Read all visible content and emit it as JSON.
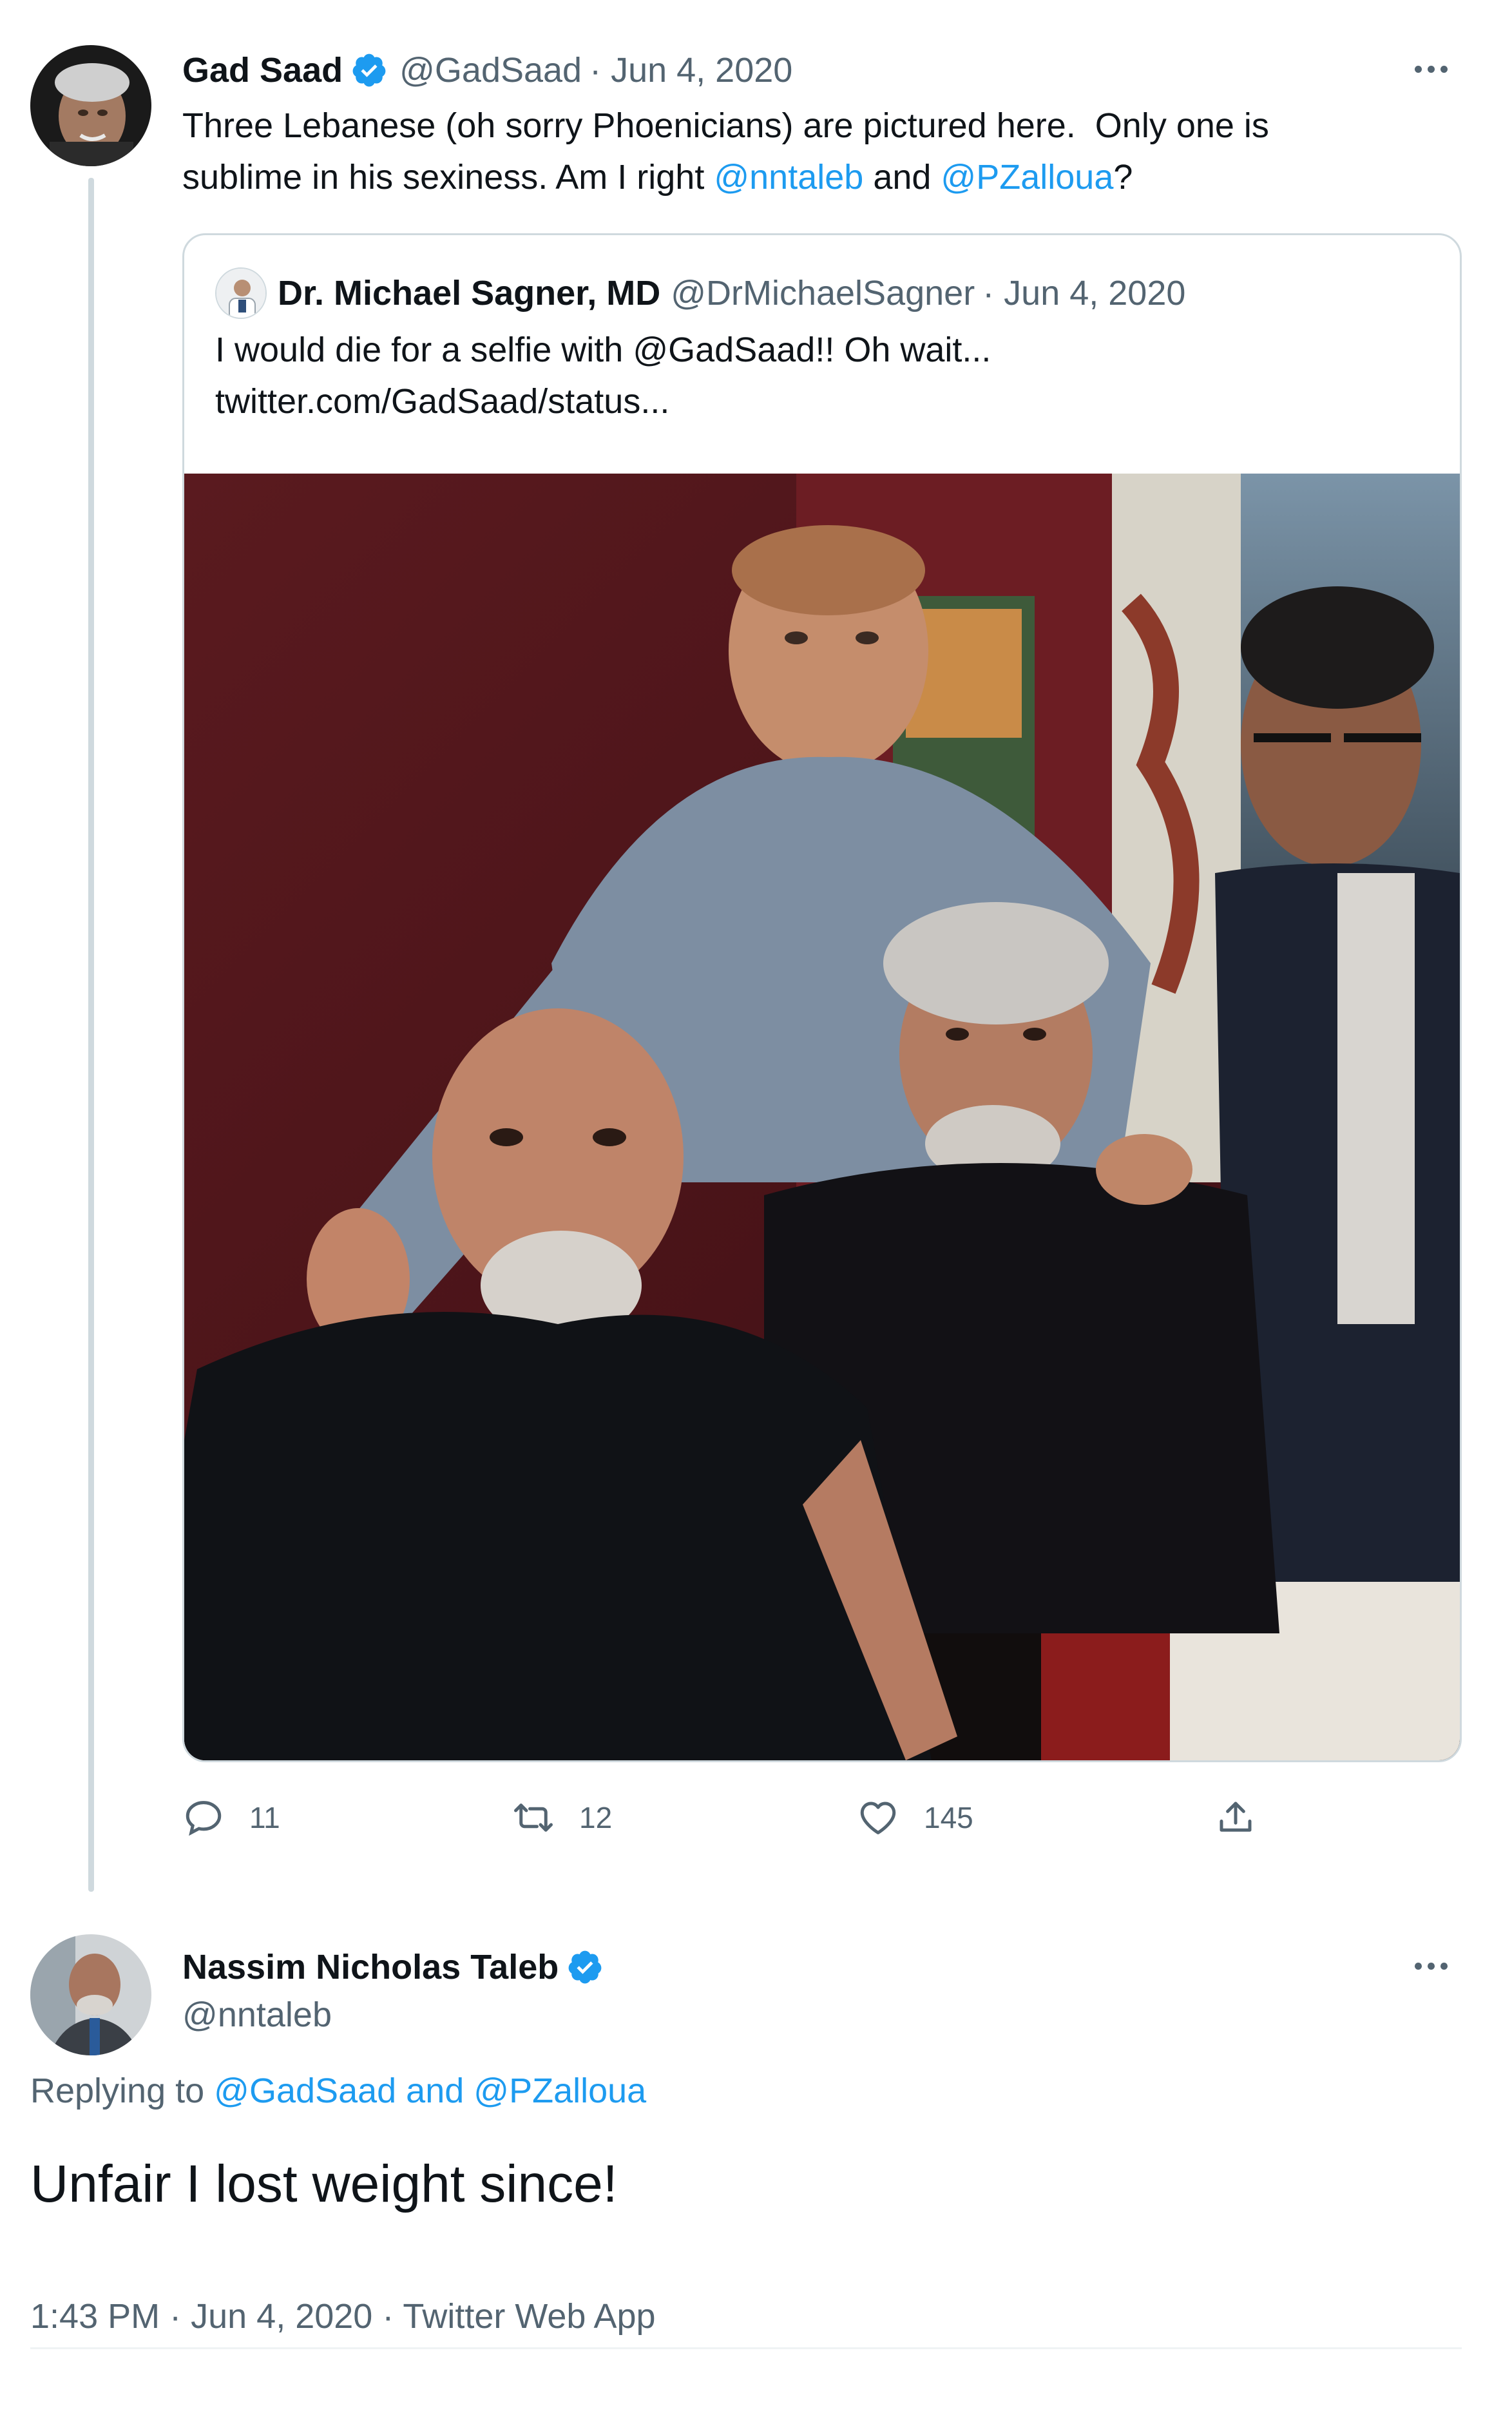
{
  "tweet1": {
    "author_name": "Gad Saad",
    "handle": "@GadSaad",
    "date": "· Jun 4, 2020",
    "text_line1": "Three Lebanese (oh sorry Phoenicians) are pictured here.  Only one is",
    "text_line2_a": "sublime in his sexiness. Am I right ",
    "mention1": "@nntaleb",
    "text_and": " and ",
    "mention2": "@PZalloua",
    "text_end": "?"
  },
  "quote": {
    "author_name": "Dr. Michael Sagner, MD",
    "handle": "@DrMichaelSagner",
    "date": "· Jun 4, 2020",
    "text_line1": "I would die for a selfie with @GadSaad!! Oh wait...",
    "text_line2": "twitter.com/GadSaad/status..."
  },
  "actions": {
    "replies": "11",
    "retweets": "12",
    "likes": "145"
  },
  "tweet2": {
    "author_name": "Nassim Nicholas Taleb",
    "handle": "@nntaleb",
    "replying_to_label": "Replying to ",
    "replying_to_users": "@GadSaad and @PZalloua",
    "text": "Unfair I lost weight since!",
    "meta": "1:43 PM · Jun 4, 2020 · Twitter Web App"
  },
  "colors": {
    "accent": "#1d9bf0",
    "text": "#0f1419",
    "muted": "#536471",
    "border": "#cfd9de"
  },
  "icons": [
    "verified-badge-icon",
    "more-options-icon",
    "reply-icon",
    "retweet-icon",
    "like-icon",
    "share-icon"
  ]
}
